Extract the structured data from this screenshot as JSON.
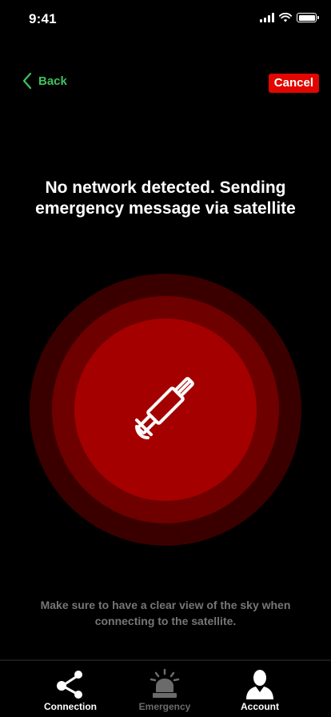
{
  "status_bar": {
    "time": "9:41"
  },
  "nav": {
    "back_label": "Back",
    "cancel_label": "Cancel"
  },
  "main": {
    "headline": "No network detected. Sending emergency message via satellite",
    "hint": "Make sure to have a clear view of the sky when connecting to the satellite.",
    "icon": "satellite-icon"
  },
  "tabs": [
    {
      "label": "Connection",
      "icon": "connection-icon",
      "active": true
    },
    {
      "label": "Emergency",
      "icon": "siren-icon",
      "active": false
    },
    {
      "label": "Account",
      "icon": "user-icon",
      "active": true
    }
  ],
  "colors": {
    "accent_green": "#3fc25d",
    "cancel_red": "#e10600",
    "ring_outer": "#3a0000",
    "ring_middle": "#6e0000",
    "ring_inner": "#a40000",
    "muted_text": "#767676"
  }
}
